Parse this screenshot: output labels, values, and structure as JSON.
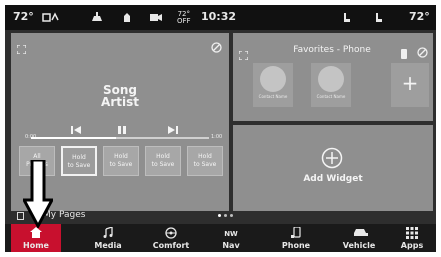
{
  "status_bar": {
    "outside_temp": "72°",
    "inside_temp_top": "72°",
    "inside_temp_bottom": "OFF",
    "time": "10:32",
    "right_temp": "72°"
  },
  "media_widget": {
    "song": "Song",
    "artist": "Artist",
    "time_start": "0:00",
    "time_end": "1:00",
    "progress": 0.48,
    "presets": [
      {
        "line1": "All",
        "line2": "Presets"
      },
      {
        "line1": "Hold",
        "line2": "to Save"
      },
      {
        "line1": "Hold",
        "line2": "to Save"
      },
      {
        "line1": "Hold",
        "line2": "to Save"
      },
      {
        "line1": "Hold",
        "line2": "to Save"
      }
    ]
  },
  "favorites_widget": {
    "title": "Favorites - Phone",
    "contacts": [
      {
        "name": "Contact Name"
      },
      {
        "name": "Contact Name"
      }
    ],
    "add_label": "+"
  },
  "add_widget": {
    "label": "Add Widget"
  },
  "my_pages": {
    "label": "My Pages"
  },
  "nav": {
    "items": [
      {
        "label": "Home",
        "sub": "",
        "icon": "home-icon"
      },
      {
        "label": "Media",
        "sub": "",
        "icon": "music-note-icon"
      },
      {
        "label": "Comfort",
        "sub": "",
        "icon": "steering-wheel-icon"
      },
      {
        "label": "Nav",
        "sub": "NW",
        "icon": "compass-icon"
      },
      {
        "label": "Phone",
        "sub": "",
        "icon": "phone-icon"
      },
      {
        "label": "Vehicle",
        "sub": "",
        "icon": "vehicle-icon"
      },
      {
        "label": "Apps",
        "sub": "",
        "icon": "apps-grid-icon"
      }
    ]
  },
  "colors": {
    "active_nav": "#c8102e",
    "panel": "#8f8f8f",
    "background": "#2e2e2e"
  }
}
